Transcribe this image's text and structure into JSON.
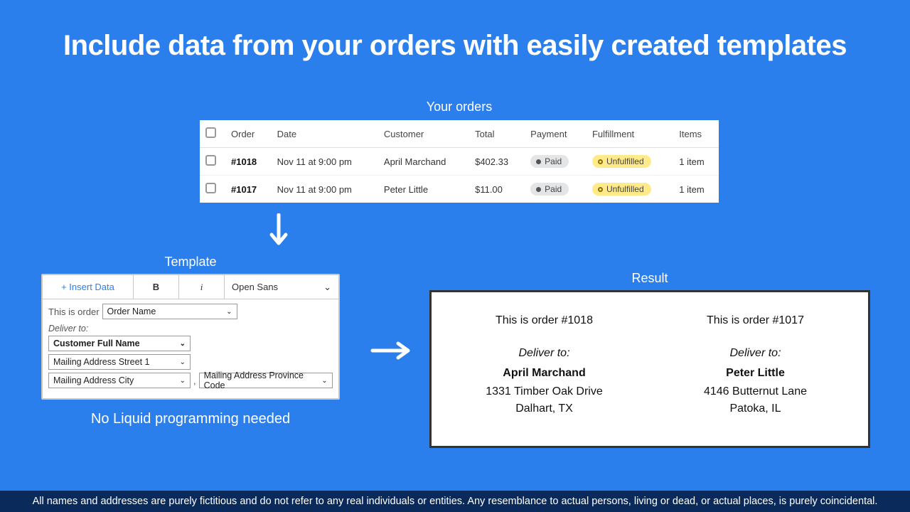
{
  "headline": "Include data from your orders with easily created templates",
  "sections": {
    "orders_label": "Your orders",
    "template_label": "Template",
    "result_label": "Result"
  },
  "orders": {
    "headers": {
      "order": "Order",
      "date": "Date",
      "customer": "Customer",
      "total": "Total",
      "payment": "Payment",
      "fulfillment": "Fulfillment",
      "items": "Items"
    },
    "rows": [
      {
        "id": "#1018",
        "date": "Nov 11 at 9:00 pm",
        "customer": "April Marchand",
        "total": "$402.33",
        "payment": "Paid",
        "fulfillment": "Unfulfilled",
        "items": "1 item"
      },
      {
        "id": "#1017",
        "date": "Nov 11 at 9:00 pm",
        "customer": "Peter Little",
        "total": "$11.00",
        "payment": "Paid",
        "fulfillment": "Unfulfilled",
        "items": "1 item"
      }
    ]
  },
  "template": {
    "toolbar": {
      "insert": "+ Insert Data",
      "bold": "B",
      "italic": "i",
      "font": "Open Sans"
    },
    "line1_prefix": "This is order",
    "order_name": "Order Name",
    "deliver_to": "Deliver to:",
    "customer_name": "Customer Full Name",
    "street1": "Mailing Address Street 1",
    "city": "Mailing Address City",
    "province": "Mailing Address Province Code",
    "comma": ",",
    "note": "No Liquid programming needed"
  },
  "result": [
    {
      "title": "This is order #1018",
      "deliver": "Deliver to:",
      "name": "April Marchand",
      "street": "1331 Timber Oak Drive",
      "citystate": "Dalhart, TX"
    },
    {
      "title": "This is order #1017",
      "deliver": "Deliver to:",
      "name": "Peter Little",
      "street": "4146  Butternut Lane",
      "citystate": "Patoka, IL"
    }
  ],
  "disclaimer": "All names and addresses are purely fictitious and do not refer to any real individuals or entities. Any resemblance to actual persons, living or dead, or actual places, is purely coincidental."
}
